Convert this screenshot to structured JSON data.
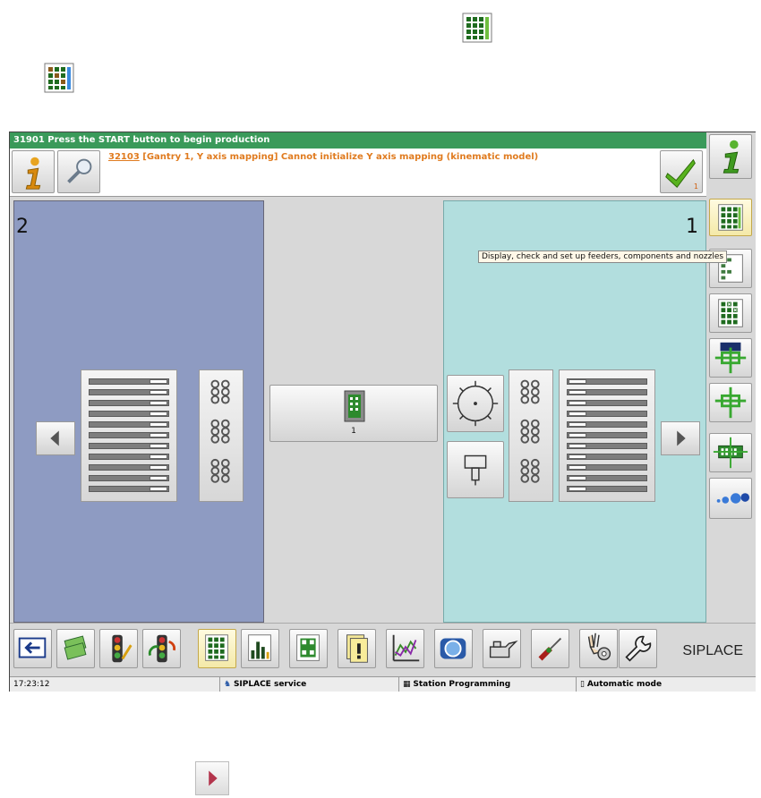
{
  "status_bar": {
    "text": "31901 Press the START button to begin production"
  },
  "message": {
    "code": "32103",
    "text": " [Gantry 1, Y axis mapping] Cannot initialize Y axis mapping (kinematic model)",
    "ack_count": "1"
  },
  "panels": {
    "left_number": "2",
    "right_number": "1",
    "center_board_label": "1"
  },
  "tooltip": {
    "text": "Display, check and set up feeders, components and nozzles"
  },
  "brand": "SIPLACE",
  "footer": {
    "time": "17:23:12",
    "user": "SIPLACE service",
    "station": "Station Programming",
    "mode": "Automatic mode"
  },
  "sidebar_icons": [
    "info-icon",
    "feeder-setup-icon",
    "component-list-icon",
    "component-check-icon",
    "gantry-head-icon",
    "pickup-icon",
    "pcb-icon",
    "nozzle-icon"
  ],
  "toolbar_icons": [
    "exit-icon",
    "money-icon",
    "traffic-light-icon",
    "traffic-light-refresh-icon",
    "feeder-grid-icon",
    "bar-chart-icon",
    "pcb-board-icon",
    "alert-document-icon",
    "graph-icon",
    "camera-icon",
    "oil-can-icon",
    "screwdriver-icon",
    "settings-hand-icon",
    "wrench-icon"
  ],
  "colors": {
    "status_green": "#3a9a5a",
    "message_orange": "#e07b1f",
    "left_panel": "#8e9bc2",
    "right_panel": "#b2dede"
  }
}
